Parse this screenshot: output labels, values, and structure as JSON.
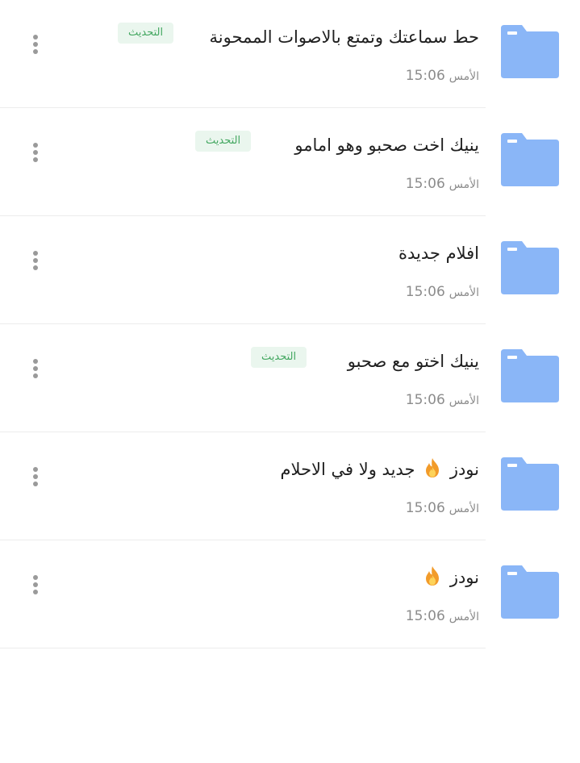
{
  "items": [
    {
      "title": "حط سماعتك وتمتع بالاصوات الممحونة",
      "badge": "التحديث",
      "day": "الأمس",
      "time": "15:06"
    },
    {
      "title": "ينيك اخت صحبو وهو امامو",
      "badge": "التحديث",
      "day": "الأمس",
      "time": "15:06"
    },
    {
      "title": "افلام جديدة",
      "badge": "",
      "day": "الأمس",
      "time": "15:06"
    },
    {
      "title": "ينيك اختو مع صحبو",
      "badge": "التحديث",
      "day": "الأمس",
      "time": "15:06"
    },
    {
      "title_pre": "نودز",
      "title_post": "جديد ولا في الاحلام",
      "badge": "",
      "day": "الأمس",
      "time": "15:06"
    },
    {
      "title_pre": "نودز",
      "title_post": "",
      "badge": "",
      "day": "الأمس",
      "time": "15:06"
    }
  ],
  "icons": {
    "folder": "folder-icon",
    "more": "more-vertical-icon",
    "fire": "fire-emoji"
  },
  "colors": {
    "folder": "#8ab6f7",
    "badge_bg": "#eaf6ee",
    "badge_text": "#43a760",
    "meta": "#8c8c8c"
  }
}
